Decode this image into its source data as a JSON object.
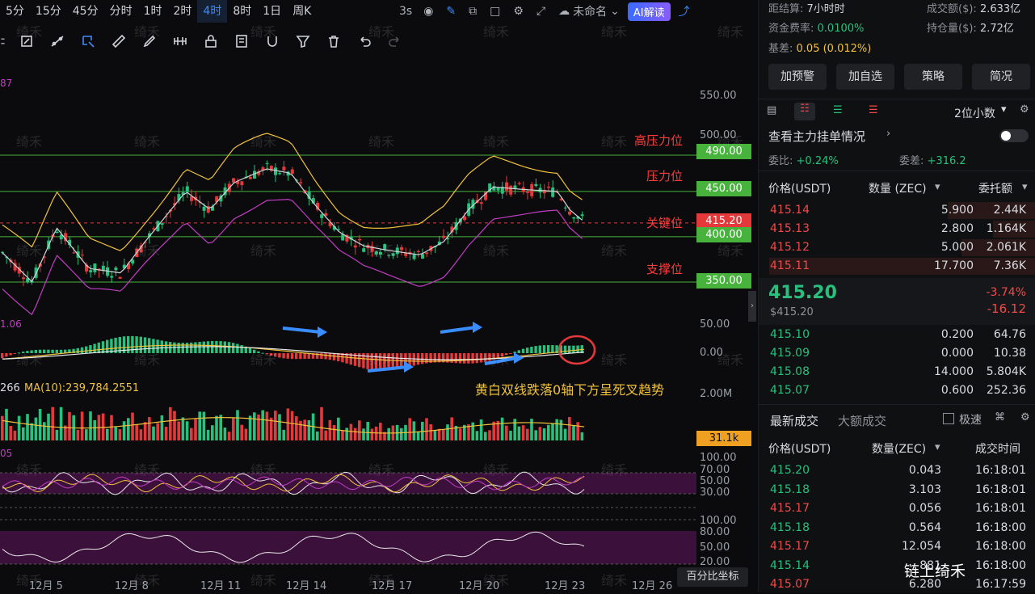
{
  "timeframes": [
    "5分",
    "15分",
    "45分",
    "分时",
    "1时",
    "2时",
    "4时",
    "8时",
    "1日",
    "周K"
  ],
  "active_timeframe": "4时",
  "toolbar_right": {
    "interval": "3s",
    "layout_name": "未命名",
    "ai_label": "AI解读"
  },
  "indicator_labels": {
    "main_value": "87",
    "macd_value": "1.06",
    "vol_value": "266",
    "vol_ma": "MA(10):239,784.2551",
    "rsi_value": "05"
  },
  "price_axis": [
    "550.00",
    "500.00"
  ],
  "levels": [
    {
      "label": "高压力位",
      "price": "490.00",
      "color": "#47b33d"
    },
    {
      "label": "压力位",
      "price": "450.00",
      "color": "#47b33d"
    },
    {
      "label": "关键位",
      "price": "415.20",
      "color": "#e5383b"
    },
    {
      "label": "",
      "price": "400.00",
      "color": "#47b33d"
    },
    {
      "label": "支撑位",
      "price": "350.00",
      "color": "#47b33d"
    }
  ],
  "macd_axis": [
    "50.00",
    "0.00"
  ],
  "vol_axis": [
    "2.00M"
  ],
  "vol_tag": "31.1k",
  "rsi_axis": [
    "100.00",
    "70.00",
    "50.00",
    "30.00"
  ],
  "kdj_axis": [
    "100.00",
    "80.00",
    "50.00",
    "20.00"
  ],
  "annotation": "黄白双线跌落0轴下方呈死叉趋势",
  "coord_button": "百分比坐标",
  "dates": [
    "12月 5",
    "12月 8",
    "12月 11",
    "12月 14",
    "12月 17",
    "12月 20",
    "12月 23",
    "12月 26"
  ],
  "watermark_text": "绮禾",
  "footer_brand": "链上绮禾",
  "stats": {
    "settle_label": "距结算:",
    "settle_value": "7小时时",
    "turnover_label": "成交额($):",
    "turnover_value": "2.633亿",
    "funding_label": "资金费率:",
    "funding_value": "0.0100%",
    "oi_label": "持仓量($):",
    "oi_value": "2.72亿",
    "basis_label": "基差:",
    "basis_value": "0.05 (0.012%)"
  },
  "action_buttons": [
    "加预警",
    "加自选",
    "策略",
    "简况"
  ],
  "decimal_select": "2位小数",
  "depth_title": "查看主力挂单情况",
  "ratio": {
    "wb_label": "委比:",
    "wb_value": "+0.24%",
    "wc_label": "委差:",
    "wc_value": "+316.2"
  },
  "ob_headers": [
    "价格(USDT)",
    "数量 (ZEC)",
    "委托额"
  ],
  "asks": [
    {
      "price": "415.14",
      "qty": "5.900",
      "amt": "2.44K",
      "depth": 0.33
    },
    {
      "price": "415.13",
      "qty": "2.800",
      "amt": "1.164K",
      "depth": 0.16
    },
    {
      "price": "415.12",
      "qty": "5.000",
      "amt": "2.061K",
      "depth": 0.28
    },
    {
      "price": "415.11",
      "qty": "17.700",
      "amt": "7.36K",
      "depth": 1.0
    }
  ],
  "last_price": "415.20",
  "last_price_usd": "$415.20",
  "change_pct": "-3.74%",
  "change_abs": "-16.12",
  "bids": [
    {
      "price": "415.10",
      "qty": "0.200",
      "amt": "64.76"
    },
    {
      "price": "415.09",
      "qty": "0.000",
      "amt": "10.38"
    },
    {
      "price": "415.08",
      "qty": "14.000",
      "amt": "5.804K"
    },
    {
      "price": "415.07",
      "qty": "0.600",
      "amt": "252.36"
    }
  ],
  "trade_tabs": [
    "最新成交",
    "大额成交"
  ],
  "fast_label": "极速",
  "trade_headers": [
    "价格(USDT)",
    "数量(ZEC)",
    "成交时间"
  ],
  "trades": [
    {
      "price": "415.20",
      "qty": "0.043",
      "time": "16:18:01",
      "side": "buy"
    },
    {
      "price": "415.18",
      "qty": "3.103",
      "time": "16:18:01",
      "side": "buy"
    },
    {
      "price": "415.17",
      "qty": "0.056",
      "time": "16:18:01",
      "side": "sell"
    },
    {
      "price": "415.18",
      "qty": "0.564",
      "time": "16:18:00",
      "side": "buy"
    },
    {
      "price": "415.17",
      "qty": "12.054",
      "time": "16:18:00",
      "side": "sell"
    },
    {
      "price": "415.14",
      "qty": "881",
      "time": "16:18:00",
      "side": "buy"
    },
    {
      "price": "415.07",
      "qty": "6.280",
      "time": "16:17:59",
      "side": "sell"
    }
  ]
}
